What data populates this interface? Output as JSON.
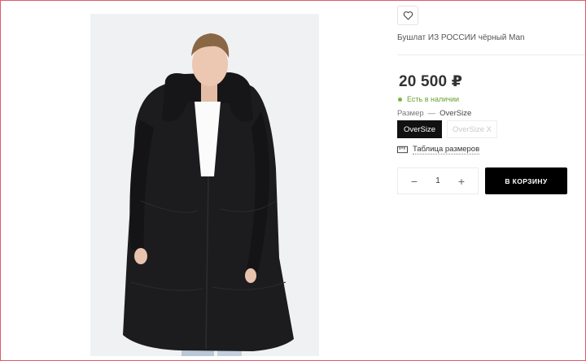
{
  "product": {
    "title": "Бушлат ИЗ РОССИИ чёрный Man",
    "price": "20 500 ₽",
    "stock": "Есть в наличии",
    "size_label": "Размер",
    "size_sep": "—",
    "size_value": "OverSize",
    "sizes": [
      "OverSize",
      "OverSize X"
    ],
    "size_table": "Таблица размеров",
    "qty_minus": "−",
    "quantity": "1",
    "qty_plus": "+",
    "add_to_cart": "В КОРЗИНУ"
  },
  "icons": {
    "favorite": "heart-icon",
    "size_table": "ruler-icon"
  },
  "colors": {
    "accent": "#000000",
    "in_stock": "#6aa12e",
    "frame": "#e05a6a"
  }
}
